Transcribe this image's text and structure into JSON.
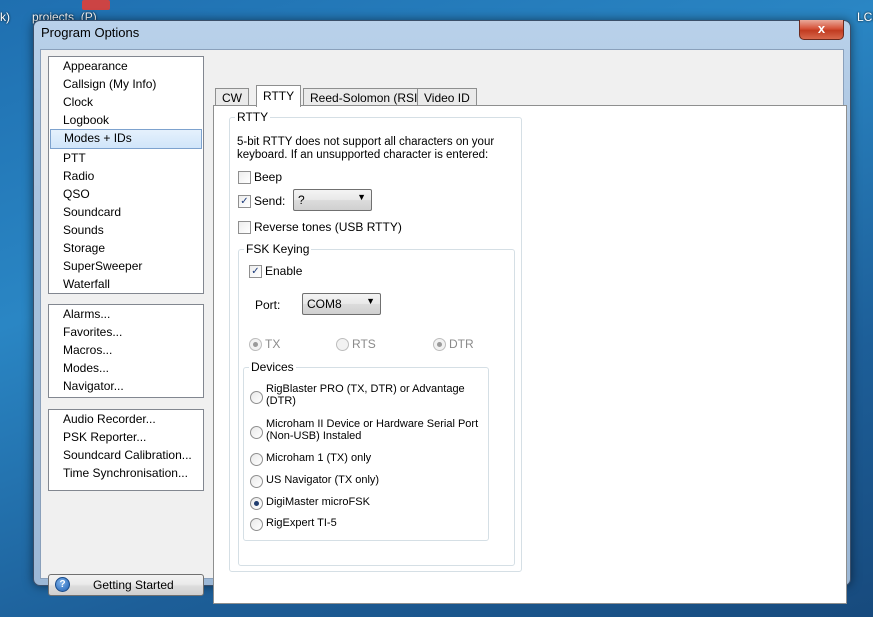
{
  "desktop": {
    "left_fragment": "k)",
    "icon_label": "projects_(P)",
    "right_fragment": "LCI"
  },
  "window": {
    "title": "Program Options",
    "close_glyph": "x"
  },
  "sidebar": {
    "group1": [
      "Appearance",
      "Callsign (My Info)",
      "Clock",
      "Logbook",
      "Modes + IDs",
      "PTT",
      "Radio",
      "QSO",
      "Soundcard",
      "Sounds",
      "Storage",
      "SuperSweeper",
      "Waterfall"
    ],
    "selected": "Modes + IDs",
    "group2": [
      "Alarms...",
      "Favorites...",
      "Macros...",
      "Modes...",
      "Navigator..."
    ],
    "group3": [
      "Audio Recorder...",
      "PSK Reporter...",
      "Soundcard Calibration...",
      "Time Synchronisation..."
    ],
    "getting_started": "Getting Started",
    "help_glyph": "?"
  },
  "tabs": [
    "CW",
    "RTTY",
    "Reed-Solomon (RSID)",
    "Video ID"
  ],
  "active_tab": "RTTY",
  "rtty": {
    "group_title": "RTTY",
    "info_line1": "5-bit RTTY does not support all characters on your",
    "info_line2": "keyboard. If an unsupported character  is entered:",
    "beep_label": "Beep",
    "send_label": "Send:",
    "send_value": "?",
    "reverse_label": "Reverse tones (USB RTTY)",
    "fsk": {
      "title": "FSK Keying",
      "enable_label": "Enable",
      "port_label": "Port:",
      "port_value": "COM8",
      "pins": [
        "TX",
        "RTS",
        "DTR"
      ],
      "devices_title": "Devices",
      "devices": [
        [
          "RigBlaster PRO (TX, DTR) or Advantage",
          "(DTR)"
        ],
        [
          "Microham II Device or Hardware Serial Port",
          "(Non-USB) Instaled"
        ],
        [
          "Microham 1 (TX) only"
        ],
        [
          "US Navigator (TX only)"
        ],
        [
          "DigiMaster microFSK"
        ],
        [
          "RigExpert TI-5"
        ]
      ],
      "selected_device": "DigiMaster microFSK"
    }
  },
  "state": {
    "beep_checked": false,
    "send_checked": true,
    "reverse_checked": false,
    "enable_checked": true,
    "check_glyph": "✓"
  }
}
